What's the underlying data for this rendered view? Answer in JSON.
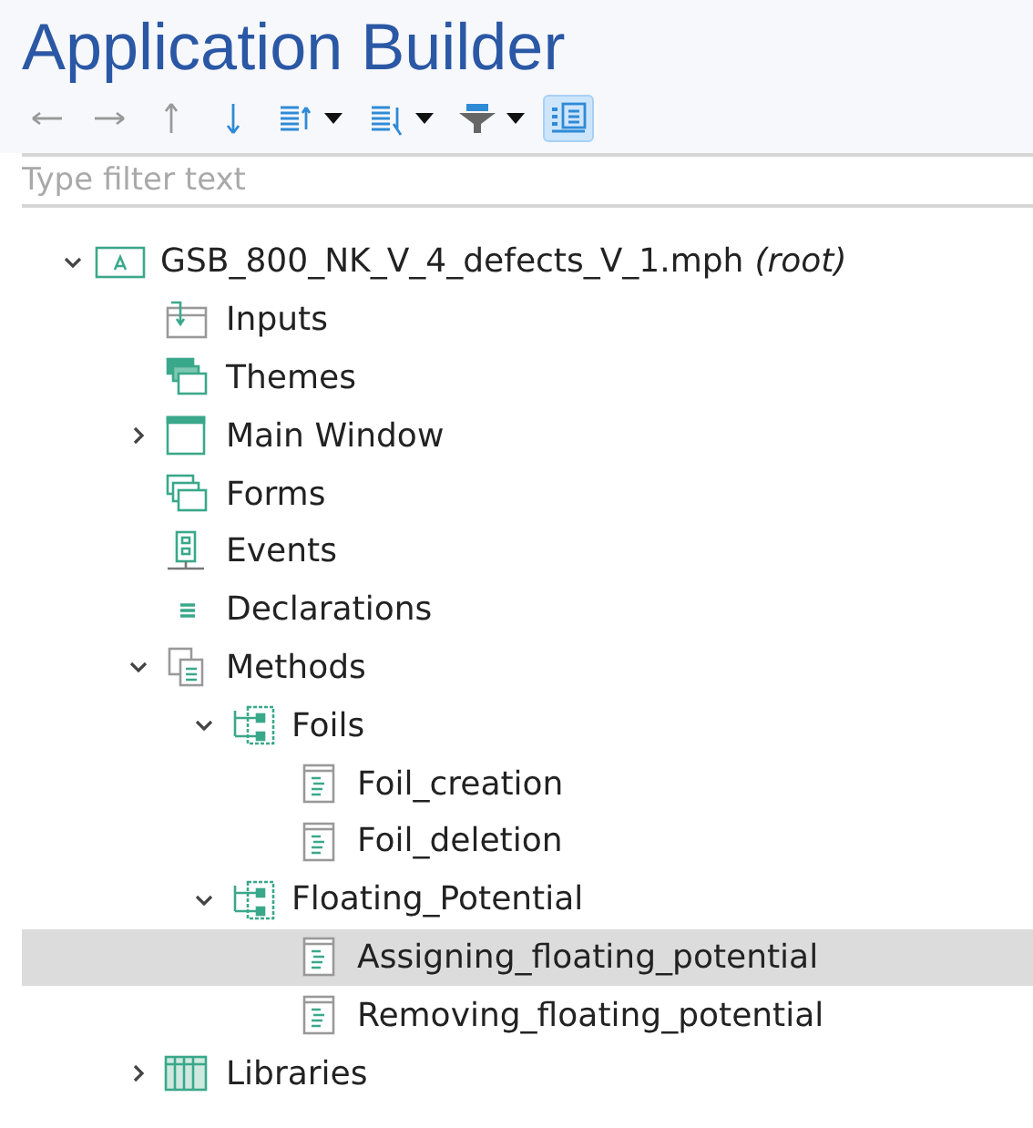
{
  "title": "Application Builder",
  "toolbar": [
    {
      "kind": "back",
      "disabled": true,
      "selected": false
    },
    {
      "kind": "forward",
      "disabled": true,
      "selected": false
    },
    {
      "kind": "up",
      "disabled": true,
      "selected": false
    },
    {
      "kind": "down",
      "disabled": false,
      "selected": false
    },
    {
      "kind": "move-up-menu",
      "disabled": false,
      "selected": false
    },
    {
      "kind": "move-down-menu",
      "disabled": false,
      "selected": false
    },
    {
      "kind": "filter-menu",
      "disabled": false,
      "selected": false
    },
    {
      "kind": "detail-view",
      "disabled": false,
      "selected": true
    }
  ],
  "filter": {
    "placeholder": "Type filter text"
  },
  "tree": [
    {
      "label": "GSB_800_NK_V_4_defects_V_1.mph",
      "note": "(root)",
      "kind": "app",
      "expanded": true,
      "selected": false,
      "children": [
        {
          "label": "Inputs",
          "kind": "inputs",
          "selected": false
        },
        {
          "label": "Themes",
          "kind": "themes",
          "selected": false
        },
        {
          "label": "Main Window",
          "kind": "window",
          "expanded": false,
          "selected": false
        },
        {
          "label": "Forms",
          "kind": "forms",
          "selected": false
        },
        {
          "label": "Events",
          "kind": "events",
          "selected": false
        },
        {
          "label": "Declarations",
          "kind": "declarations",
          "selected": false
        },
        {
          "label": "Methods",
          "kind": "methods",
          "expanded": true,
          "selected": false,
          "children": [
            {
              "label": "Foils",
              "kind": "group",
              "expanded": true,
              "selected": false,
              "children": [
                {
                  "label": "Foil_creation",
                  "kind": "method",
                  "selected": false
                },
                {
                  "label": "Foil_deletion",
                  "kind": "method",
                  "selected": false
                }
              ]
            },
            {
              "label": "Floating_Potential",
              "kind": "group",
              "expanded": true,
              "selected": false,
              "children": [
                {
                  "label": "Assigning_floating_potential",
                  "kind": "method",
                  "selected": true
                },
                {
                  "label": "Removing_floating_potential",
                  "kind": "method",
                  "selected": false
                }
              ]
            }
          ]
        },
        {
          "label": "Libraries",
          "kind": "libraries",
          "expanded": false,
          "selected": false
        }
      ]
    }
  ]
}
